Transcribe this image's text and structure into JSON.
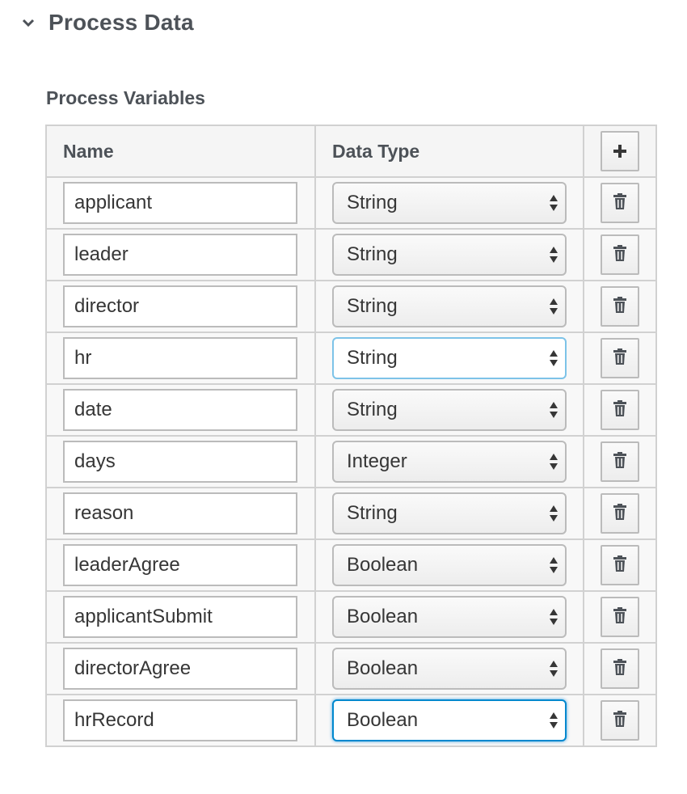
{
  "section": {
    "title": "Process Data"
  },
  "variables": {
    "title": "Process Variables",
    "headers": {
      "name": "Name",
      "data_type": "Data Type"
    },
    "rows": [
      {
        "name": "applicant",
        "type": "String"
      },
      {
        "name": "leader",
        "type": "String"
      },
      {
        "name": "director",
        "type": "String"
      },
      {
        "name": "hr",
        "type": "String"
      },
      {
        "name": "date",
        "type": "String"
      },
      {
        "name": "days",
        "type": "Integer"
      },
      {
        "name": "reason",
        "type": "String"
      },
      {
        "name": "leaderAgree",
        "type": "Boolean"
      },
      {
        "name": "applicantSubmit",
        "type": "Boolean"
      },
      {
        "name": "directorAgree",
        "type": "Boolean"
      },
      {
        "name": "hrRecord",
        "type": "Boolean"
      }
    ]
  },
  "icons": {
    "collapse": "chevron-down-icon",
    "add": "plus-icon",
    "delete": "trash-icon",
    "select": "select-arrows-icon"
  },
  "colors": {
    "heading": "#4d5258",
    "focus_border": "#0088ce",
    "focus_border_light": "#7dc3e8"
  }
}
